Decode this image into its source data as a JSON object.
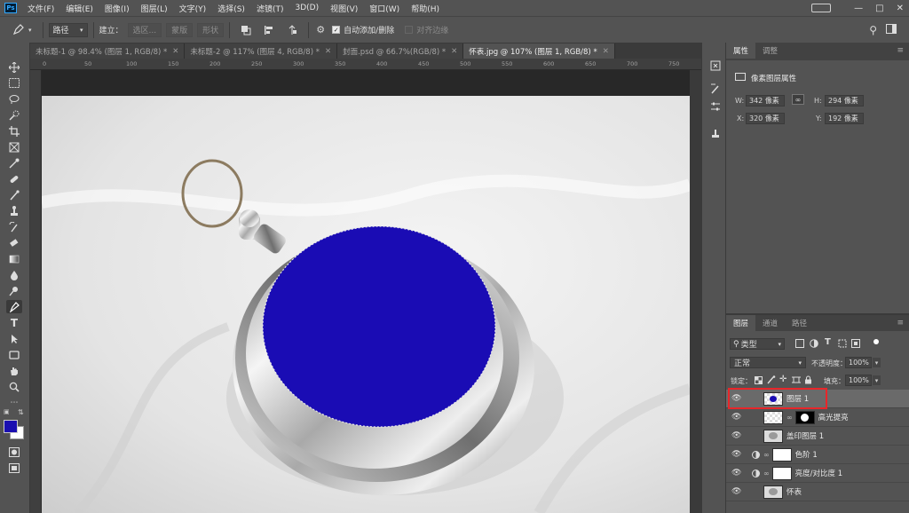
{
  "menu": [
    "文件(F)",
    "编辑(E)",
    "图像(I)",
    "图层(L)",
    "文字(Y)",
    "选择(S)",
    "滤镜(T)",
    "3D(D)",
    "视图(V)",
    "窗口(W)",
    "帮助(H)"
  ],
  "app_logo": "Ps",
  "options": {
    "mode_value": "路径",
    "make_label": "建立：",
    "selection_btn": "选区...",
    "mask_btn": "蒙版",
    "shape_btn": "形状",
    "auto_add_label": "自动添加/删除",
    "align_edges_label": "对齐边缘"
  },
  "tabs": [
    {
      "label": "未标题-1 @ 98.4% (图层 1, RGB/8) *",
      "active": false
    },
    {
      "label": "未标题-2 @ 117% (图层 4, RGB/8) *",
      "active": false
    },
    {
      "label": "封面.psd @ 66.7%(RGB/8) *",
      "active": false
    },
    {
      "label": "怀表.jpg @ 107% (图层 1, RGB/8) *",
      "active": true
    }
  ],
  "ruler_ticks": [
    "0",
    "50",
    "100",
    "150",
    "200",
    "250",
    "300",
    "350",
    "400",
    "450",
    "500",
    "550",
    "600",
    "650",
    "700",
    "750"
  ],
  "properties": {
    "tabs": [
      "属性",
      "调整"
    ],
    "title": "像素图层属性",
    "w_label": "W:",
    "w_value": "342 像素",
    "h_label": "H:",
    "h_value": "294 像素",
    "x_label": "X:",
    "x_value": "320 像素",
    "y_label": "Y:",
    "y_value": "192 像素"
  },
  "layers_panel": {
    "tabs": [
      "图层",
      "通道",
      "路径"
    ],
    "filter_label": "类型",
    "blend_mode": "正常",
    "opacity_label": "不透明度：",
    "opacity_value": "100%",
    "lock_label": "锁定：",
    "fill_label": "填充：",
    "fill_value": "100%",
    "layers": [
      {
        "name": "图层 1",
        "selected": true
      },
      {
        "name": "高光提亮",
        "selected": false
      },
      {
        "name": "盖印图层 1",
        "selected": false
      },
      {
        "name": "色阶 1",
        "selected": false
      },
      {
        "name": "亮度/对比度 1",
        "selected": false
      },
      {
        "name": "怀表",
        "selected": false
      }
    ]
  },
  "colors": {
    "foreground": "#1a0fb0",
    "background": "#ffffff",
    "fill_blue": "#1a0cb4",
    "highlight_box": "#e8262a"
  }
}
